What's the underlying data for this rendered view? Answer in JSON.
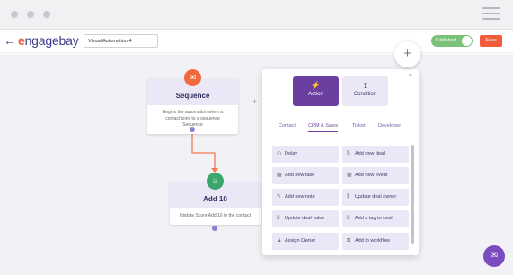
{
  "header": {
    "back_icon": "arrow-left-icon",
    "logo_e": "e",
    "logo_rest": "ngagebay",
    "automation_name": "Visual Automation 4",
    "publish_label": "Published",
    "save_label": "Save",
    "menu_icon": "hamburger-icon"
  },
  "nodes": {
    "sequence": {
      "title": "Sequence",
      "desc": "Begins the automation when a contact joins to a sequence Sequence",
      "icon": "mail-icon"
    },
    "add10": {
      "title": "Add 10",
      "desc": "Update Score Add 10 to the contact",
      "icon": "flame-icon"
    }
  },
  "panel": {
    "close": "×",
    "types": {
      "action": "Action",
      "condition": "Condition"
    },
    "tabs": [
      "Contact",
      "CRM & Sales",
      "Ticket",
      "Developer"
    ],
    "actions": [
      {
        "label": "Delay",
        "icon": "clock-icon"
      },
      {
        "label": "Add new deal",
        "icon": "dollar-icon"
      },
      {
        "label": "Add new task",
        "icon": "calendar-icon"
      },
      {
        "label": "Add new event",
        "icon": "calendar-icon"
      },
      {
        "label": "Add new note",
        "icon": "edit-icon"
      },
      {
        "label": "Update deal owner",
        "icon": "dollar-icon"
      },
      {
        "label": "Update deal value",
        "icon": "dollar-icon"
      },
      {
        "label": "Add a tag to deal",
        "icon": "dollar-icon"
      },
      {
        "label": "Assign Owner",
        "icon": "user-icon"
      },
      {
        "label": "Add to workflow",
        "icon": "workflow-icon"
      }
    ]
  },
  "colors": {
    "accent": "#6b3fa0",
    "brand_orange": "#f05d3b",
    "toggle_green": "#7ac27a",
    "node_green": "#3aa66b"
  }
}
